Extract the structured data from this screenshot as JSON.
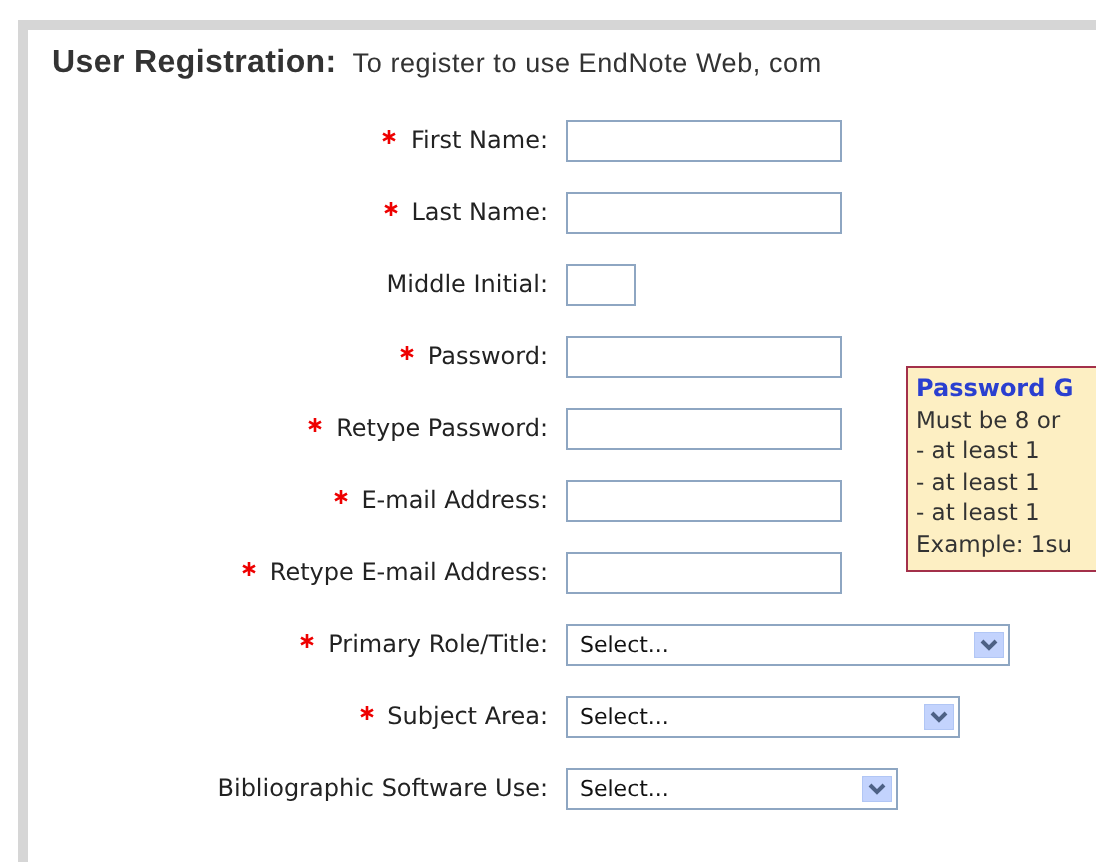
{
  "header": {
    "title": "User Registration:",
    "intro": "To register to use EndNote Web, com"
  },
  "fields": [
    {
      "label": "First Name:",
      "required": true,
      "kind": "text"
    },
    {
      "label": "Last Name:",
      "required": true,
      "kind": "text"
    },
    {
      "label": "Middle Initial:",
      "required": false,
      "kind": "initial"
    },
    {
      "label": "Password:",
      "required": true,
      "kind": "text"
    },
    {
      "label": "Retype Password:",
      "required": true,
      "kind": "text"
    },
    {
      "label": "E-mail Address:",
      "required": true,
      "kind": "text"
    },
    {
      "label": "Retype E-mail Address:",
      "required": true,
      "kind": "text"
    },
    {
      "label": "Primary Role/Title:",
      "required": true,
      "kind": "select",
      "value": "Select..."
    },
    {
      "label": "Subject Area:",
      "required": true,
      "kind": "select",
      "value": "Select..."
    },
    {
      "label": "Bibliographic Software Use:",
      "required": false,
      "kind": "select",
      "value": "Select..."
    }
  ],
  "password_guide": {
    "title": "Password G",
    "lines": [
      "Must be 8 or",
      "- at least 1",
      "- at least 1",
      "- at least 1",
      "Example: 1su"
    ]
  }
}
